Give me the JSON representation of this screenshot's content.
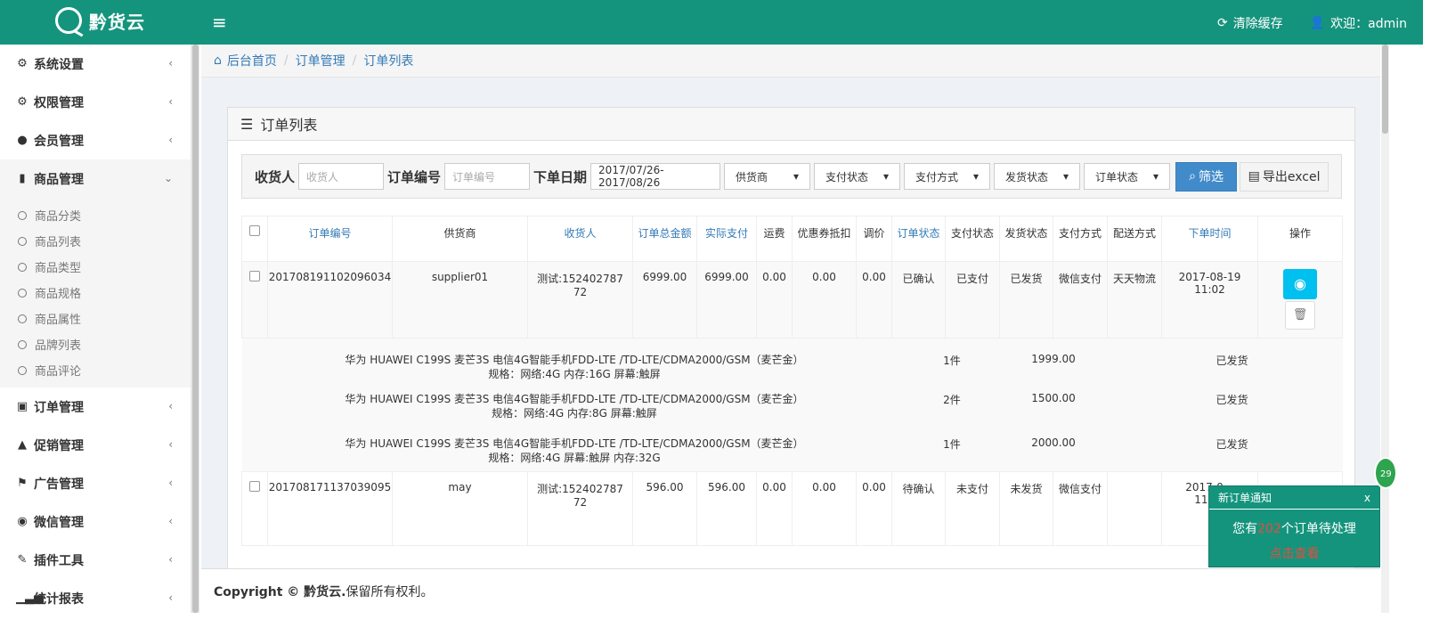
{
  "topbar": {
    "brand": "黔货云",
    "clear_cache": "清除缓存",
    "welcome": "欢迎：admin"
  },
  "breadcrumb": [
    "后台首页",
    "订单管理",
    "订单列表"
  ],
  "sidebar": {
    "items": [
      {
        "label": "系统设置",
        "icon": "gear-icon"
      },
      {
        "label": "权限管理",
        "icon": "gears-icon"
      },
      {
        "label": "会员管理",
        "icon": "user-icon"
      },
      {
        "label": "商品管理",
        "icon": "book-icon"
      },
      {
        "label": "订单管理",
        "icon": "money-icon"
      },
      {
        "label": "促销管理",
        "icon": "bell-icon"
      },
      {
        "label": "广告管理",
        "icon": "flag-icon"
      },
      {
        "label": "微信管理",
        "icon": "wechat-icon"
      },
      {
        "label": "插件工具",
        "icon": "wrench-icon"
      },
      {
        "label": "统计报表",
        "icon": "signal-icon"
      }
    ],
    "sub_items": [
      "商品分类",
      "商品列表",
      "商品类型",
      "商品规格",
      "商品属性",
      "品牌列表",
      "商品评论"
    ]
  },
  "panel": {
    "title": "订单列表"
  },
  "filter": {
    "receiver_label": "收货人",
    "receiver_placeholder": "收货人",
    "order_no_label": "订单编号",
    "order_no_placeholder": "订单编号",
    "date_label": "下单日期",
    "date_value": "2017/07/26-2017/08/26",
    "supplier": "供货商",
    "pay_status": "支付状态",
    "pay_method": "支付方式",
    "ship_status": "发货状态",
    "order_status": "订单状态",
    "filter_btn": "筛选",
    "export_btn": "导出excel"
  },
  "table": {
    "headers": [
      "订单编号",
      "供货商",
      "收货人",
      "订单总金额",
      "实际支付",
      "运费",
      "优惠券抵扣",
      "调价",
      "订单状态",
      "支付状态",
      "发货状态",
      "支付方式",
      "配送方式",
      "下单时间",
      "操作"
    ],
    "rows": [
      {
        "order_no": "201708191102096034",
        "supplier": "supplier01",
        "receiver": "测试:15240278772",
        "total": "6999.00",
        "paid": "6999.00",
        "freight": "0.00",
        "coupon": "0.00",
        "adjust": "0.00",
        "order_status": "已确认",
        "pay_status": "已支付",
        "ship_status": "已发货",
        "pay_method": "微信支付",
        "ship_method": "天天物流",
        "time": "2017-08-19 11:02"
      },
      {
        "order_no": "201708171137039095",
        "supplier": "may",
        "receiver": "测试:15240278772",
        "total": "596.00",
        "paid": "596.00",
        "freight": "0.00",
        "coupon": "0.00",
        "adjust": "0.00",
        "order_status": "待确认",
        "pay_status": "未支付",
        "ship_status": "未发货",
        "pay_method": "微信支付",
        "ship_method": "",
        "time": "2017-0… 11:37"
      }
    ],
    "items": [
      {
        "name": "华为 HUAWEI C199S 麦芒3S 电信4G智能手机FDD-LTE /TD-LTE/CDMA2000/GSM（麦芒金）",
        "spec": "规格：网络:4G 内存:16G 屏幕:触屏",
        "qty": "1件",
        "price": "1999.00",
        "status": "已发货"
      },
      {
        "name": "华为 HUAWEI C199S 麦芒3S 电信4G智能手机FDD-LTE /TD-LTE/CDMA2000/GSM（麦芒金）",
        "spec": "规格：网络:4G 内存:8G 屏幕:触屏",
        "qty": "2件",
        "price": "1500.00",
        "status": "已发货"
      },
      {
        "name": "华为 HUAWEI C199S 麦芒3S 电信4G智能手机FDD-LTE /TD-LTE/CDMA2000/GSM（麦芒金）",
        "spec": "规格：网络:4G 屏幕:触屏 内存:32G",
        "qty": "1件",
        "price": "2000.00",
        "status": "已发货"
      }
    ]
  },
  "footer": {
    "copyright": "Copyright © 黔货云.",
    "rights": "保留所有权利。"
  },
  "toast": {
    "title": "新订单通知",
    "close": "x",
    "pre": "您有",
    "count": "202",
    "post": "个订单待处理",
    "link": "点击查看"
  },
  "badge": "29",
  "colors": {
    "brand": "#15947d",
    "primary": "#428bca",
    "info": "#00c0ef",
    "link": "#337ab7"
  }
}
